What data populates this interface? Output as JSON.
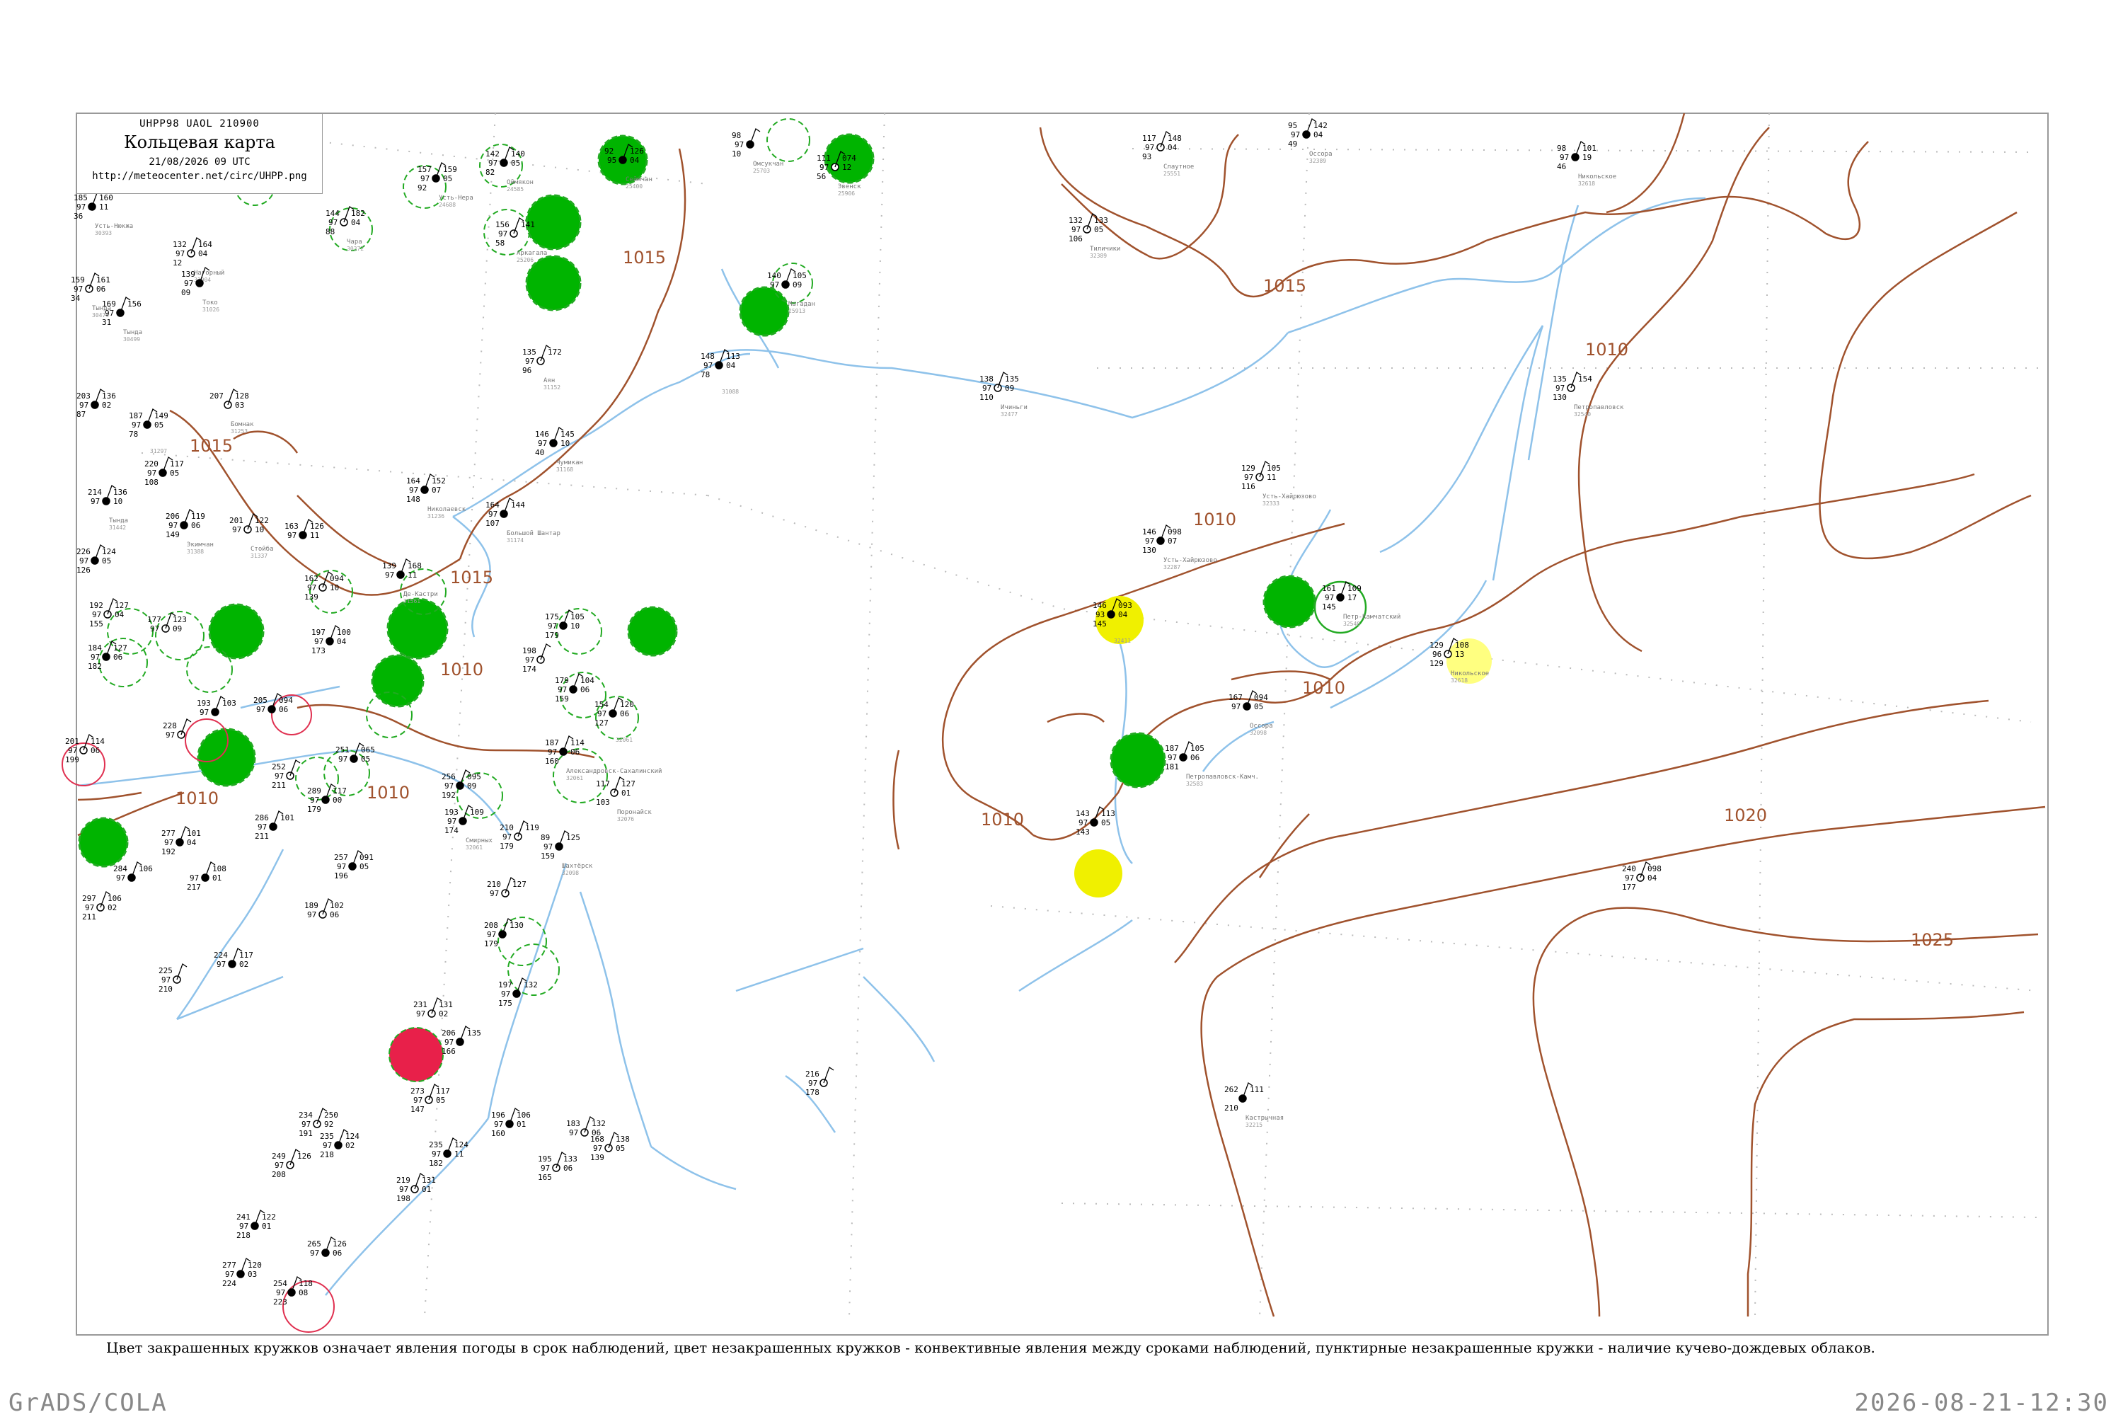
{
  "header": {
    "code": "UHPP98  UAOL  210900",
    "title": "Кольцевая карта",
    "datetime": "21/08/2026 09 UTC",
    "url": "http://meteocenter.net/circ/UHPP.png"
  },
  "caption": "Цвет закрашенных кружков означает явления погоды в срок наблюдений, цвет незакрашенных кружков - конвективные явления между сроками наблюдений, пунктирные незакрашенные кружки - наличие кучево-дождевых облаков.",
  "footer": {
    "left": "GrADS/COLA",
    "right": "2026-08-21-12:30"
  },
  "colors": {
    "isobar": "#a0522d",
    "river": "#87bde8",
    "green_fill": "#00b400",
    "yellow_fill": "#f0f000",
    "light_yellow_fill": "#ffff80",
    "red_fill": "#e8204a",
    "dashed_green": "#22aa22",
    "red_ring": "#e03050"
  },
  "isobar_labels": [
    {
      "text": "1015",
      "id": "a"
    },
    {
      "text": "1015",
      "id": "b"
    },
    {
      "text": "1015",
      "id": "c"
    },
    {
      "text": "1015",
      "id": "d"
    },
    {
      "text": "1010",
      "id": "e"
    },
    {
      "text": "1010",
      "id": "f"
    },
    {
      "text": "1010",
      "id": "g"
    },
    {
      "text": "1010",
      "id": "h"
    },
    {
      "text": "1010",
      "id": "i"
    },
    {
      "text": "1010",
      "id": "j"
    },
    {
      "text": "1020",
      "id": "k"
    },
    {
      "text": "1025",
      "id": "l"
    },
    {
      "text": "1010",
      "id": "m"
    }
  ],
  "stations": [
    {
      "id": "s1",
      "a": "185",
      "b": "97",
      "c": "36",
      "r": "160",
      "s": "11",
      "name": "Усть-Нюкжа",
      "wmo": "30393"
    },
    {
      "id": "s2",
      "a": "144",
      "b": "97",
      "c": "88",
      "r": "182",
      "s": "04",
      "name": "Чара",
      "wmo": "30372"
    },
    {
      "id": "s3",
      "a": "157",
      "b": "97",
      "c": "92",
      "r": "159",
      "s": "05",
      "name": "Усть-Нера",
      "wmo": "24688"
    },
    {
      "id": "s4",
      "a": "142",
      "b": "97",
      "c": "82",
      "r": "140",
      "s": "05",
      "name": "Оймякон",
      "wmo": "24585"
    },
    {
      "id": "s5",
      "a": "92",
      "b": "95",
      "c": "",
      "r": "126",
      "s": "04",
      "name": "Сеймчан",
      "wmo": "25400"
    },
    {
      "id": "s6",
      "a": "98",
      "b": "97",
      "c": "10",
      "r": "",
      "s": "",
      "name": "Омсукчан",
      "wmo": "25703"
    },
    {
      "id": "s7",
      "a": "111",
      "b": "97",
      "c": "56",
      "r": "074",
      "s": "12",
      "name": "Эвенск",
      "wmo": "25906"
    },
    {
      "id": "s8",
      "a": "117",
      "b": "97",
      "c": "93",
      "r": "148",
      "s": "04",
      "name": "Слаутное",
      "wmo": "25551"
    },
    {
      "id": "s9",
      "a": "95",
      "b": "97",
      "c": "49",
      "r": "142",
      "s": "04",
      "name": "Оссора",
      "wmo": "32389"
    },
    {
      "id": "s10",
      "a": "98",
      "b": "97",
      "c": "46",
      "r": "101",
      "s": "19",
      "name": "Никольское",
      "wmo": "32618"
    },
    {
      "id": "s11",
      "a": "132",
      "b": "97",
      "c": "12",
      "r": "164",
      "s": "04",
      "name": "Нагорный",
      "wmo": "31004"
    },
    {
      "id": "s12",
      "a": "139",
      "b": "97",
      "c": "09",
      "r": "",
      "s": "",
      "name": "Токо",
      "wmo": "31026"
    },
    {
      "id": "s13",
      "a": "156",
      "b": "97",
      "c": "58",
      "r": "141",
      "s": "",
      "name": "Аркагала",
      "wmo": "25206"
    },
    {
      "id": "s14",
      "a": "140",
      "b": "97",
      "c": "",
      "r": "105",
      "s": "09",
      "name": "Магадан",
      "wmo": "25913"
    },
    {
      "id": "s15",
      "a": "132",
      "b": "97",
      "c": "106",
      "r": "133",
      "s": "05",
      "name": "Тиличики",
      "wmo": "32389"
    },
    {
      "id": "s16",
      "a": "159",
      "b": "97",
      "c": "34",
      "r": "161",
      "s": "06",
      "name": "Тында",
      "wmo": "30479"
    },
    {
      "id": "s17",
      "a": "169",
      "b": "97",
      "c": "31",
      "r": "156",
      "s": "",
      "name": "Тында",
      "wmo": "30499"
    },
    {
      "id": "s18",
      "a": "135",
      "b": "97",
      "c": "96",
      "r": "172",
      "s": "",
      "name": "Аян",
      "wmo": "31152"
    },
    {
      "id": "s19",
      "a": "148",
      "b": "97",
      "c": "78",
      "r": "113",
      "s": "04",
      "name": "",
      "wmo": "31088"
    },
    {
      "id": "s20",
      "a": "138",
      "b": "97",
      "c": "110",
      "r": "135",
      "s": "09",
      "name": "Ичиньги",
      "wmo": "32477"
    },
    {
      "id": "s21",
      "a": "135",
      "b": "97",
      "c": "130",
      "r": "154",
      "s": "",
      "name": "Петропавловск",
      "wmo": "32540"
    },
    {
      "id": "s22",
      "a": "203",
      "b": "97",
      "c": "87",
      "r": "136",
      "s": "02",
      "name": "",
      "wmo": ""
    },
    {
      "id": "s23",
      "a": "207",
      "b": "",
      "c": "",
      "r": "128",
      "s": "03",
      "name": "Бомнак",
      "wmo": "31253"
    },
    {
      "id": "s24",
      "a": "187",
      "b": "97",
      "c": "78",
      "r": "149",
      "s": "05",
      "name": "",
      "wmo": "31297"
    },
    {
      "id": "s25",
      "a": "146",
      "b": "97",
      "c": "40",
      "r": "145",
      "s": "10",
      "name": "Чумикан",
      "wmo": "31168"
    },
    {
      "id": "s26",
      "a": "164",
      "b": "97",
      "c": "148",
      "r": "152",
      "s": "07",
      "name": "Николаевск",
      "wmo": "31236"
    },
    {
      "id": "s27",
      "a": "164",
      "b": "97",
      "c": "107",
      "r": "144",
      "s": "",
      "name": "Большой Шантар",
      "wmo": "31174"
    },
    {
      "id": "s28",
      "a": "129",
      "b": "97",
      "c": "116",
      "r": "105",
      "s": "11",
      "name": "Усть-Хайрюзово",
      "wmo": "32333"
    },
    {
      "id": "s29",
      "a": "146",
      "b": "97",
      "c": "130",
      "r": "098",
      "s": "07",
      "name": "Усть-Хайрюзово",
      "wmo": "32287"
    },
    {
      "id": "s30",
      "a": "220",
      "b": "97",
      "c": "108",
      "r": "117",
      "s": "05",
      "name": "",
      "wmo": ""
    },
    {
      "id": "s31",
      "a": "214",
      "b": "97",
      "c": "",
      "r": "136",
      "s": "10",
      "name": "Тында",
      "wmo": "31442"
    },
    {
      "id": "s32",
      "a": "206",
      "b": "97",
      "c": "149",
      "r": "119",
      "s": "06",
      "name": "Экимчан",
      "wmo": "31388"
    },
    {
      "id": "s33",
      "a": "201",
      "b": "97",
      "c": "",
      "r": "122",
      "s": "10",
      "name": "Стойба",
      "wmo": "31337"
    },
    {
      "id": "s34",
      "a": "163",
      "b": "97",
      "c": "",
      "r": "126",
      "s": "11",
      "name": "",
      "wmo": ""
    },
    {
      "id": "s35",
      "a": "226",
      "b": "97",
      "c": "126",
      "r": "124",
      "s": "05",
      "name": "",
      "wmo": ""
    },
    {
      "id": "s36",
      "a": "162",
      "b": "97",
      "c": "139",
      "r": "094",
      "s": "10",
      "name": "",
      "wmo": ""
    },
    {
      "id": "s37",
      "a": "139",
      "b": "97",
      "c": "",
      "r": "168",
      "s": "11",
      "name": "Де-Кастри",
      "wmo": "31561"
    },
    {
      "id": "s38",
      "a": "146",
      "b": "93",
      "c": "145",
      "r": "093",
      "s": "04",
      "name": "",
      "wmo": "32411"
    },
    {
      "id": "s39",
      "a": "129",
      "b": "96",
      "c": "129",
      "r": "108",
      "s": "13",
      "name": "Никольское",
      "wmo": "32618"
    },
    {
      "id": "s40",
      "a": "161",
      "b": "97",
      "c": "145",
      "r": "109",
      "s": "17",
      "name": "Петр-Камчатский",
      "wmo": "32540"
    },
    {
      "id": "s41",
      "a": "192",
      "b": "97",
      "c": "155",
      "r": "127",
      "s": "04",
      "name": "",
      "wmo": ""
    },
    {
      "id": "s42",
      "a": "177",
      "b": "97",
      "c": "",
      "r": "123",
      "s": "09",
      "name": "",
      "wmo": ""
    },
    {
      "id": "s43",
      "a": "197",
      "b": "97",
      "c": "173",
      "r": "100",
      "s": "04",
      "name": "",
      "wmo": ""
    },
    {
      "id": "s44",
      "a": "175",
      "b": "97",
      "c": "179",
      "r": "105",
      "s": "10",
      "name": "",
      "wmo": ""
    },
    {
      "id": "s45",
      "a": "184",
      "b": "97",
      "c": "182",
      "r": "127",
      "s": "06",
      "name": "",
      "wmo": ""
    },
    {
      "id": "s46",
      "a": "198",
      "b": "97",
      "c": "174",
      "r": "",
      "s": "",
      "name": "",
      "wmo": ""
    },
    {
      "id": "s47",
      "a": "179",
      "b": "97",
      "c": "159",
      "r": "104",
      "s": "06",
      "name": "",
      "wmo": ""
    },
    {
      "id": "s48",
      "a": "154",
      "b": "97",
      "c": "127",
      "r": "120",
      "s": "06",
      "name": "",
      "wmo": "32061"
    },
    {
      "id": "s49",
      "a": "167",
      "b": "97",
      "c": "",
      "r": "094",
      "s": "05",
      "name": "Оссора",
      "wmo": "32098"
    },
    {
      "id": "s50",
      "a": "187",
      "b": "97",
      "c": "181",
      "r": "105",
      "s": "06",
      "name": "Петропавловск-Камч.",
      "wmo": "32583"
    },
    {
      "id": "s51",
      "a": "201",
      "b": "97",
      "c": "199",
      "r": "114",
      "s": "06",
      "name": "",
      "wmo": ""
    },
    {
      "id": "s52",
      "a": "193",
      "b": "97",
      "c": "",
      "r": "103",
      "s": "",
      "name": "",
      "wmo": ""
    },
    {
      "id": "s53",
      "a": "205",
      "b": "97",
      "c": "",
      "r": "094",
      "s": "06",
      "name": "",
      "wmo": ""
    },
    {
      "id": "s54",
      "a": "228",
      "b": "97",
      "c": "",
      "r": "",
      "s": "",
      "name": "",
      "wmo": ""
    },
    {
      "id": "s55",
      "a": "252",
      "b": "97",
      "c": "211",
      "r": "",
      "s": "",
      "name": "",
      "wmo": ""
    },
    {
      "id": "s56",
      "a": "251",
      "b": "97",
      "c": "",
      "r": "065",
      "s": "05",
      "name": "",
      "wmo": ""
    },
    {
      "id": "s57",
      "a": "289",
      "b": "97",
      "c": "179",
      "r": "117",
      "s": "00",
      "name": "",
      "wmo": ""
    },
    {
      "id": "s58",
      "a": "256",
      "b": "97",
      "c": "192",
      "r": "095",
      "s": "09",
      "name": "",
      "wmo": ""
    },
    {
      "id": "s59",
      "a": "193",
      "b": "97",
      "c": "174",
      "r": "109",
      "s": "",
      "name": "Смирных",
      "wmo": "32061"
    },
    {
      "id": "s60",
      "a": "187",
      "b": "97",
      "c": "160",
      "r": "114",
      "s": "06",
      "name": "Александровск-Сахалинский",
      "wmo": "32061"
    },
    {
      "id": "s61",
      "a": "117",
      "b": "",
      "c": "103",
      "r": "127",
      "s": "01",
      "name": "Поронайск",
      "wmo": "32076"
    },
    {
      "id": "s62",
      "a": "210",
      "b": "97",
      "c": "179",
      "r": "119",
      "s": "",
      "name": "",
      "wmo": ""
    },
    {
      "id": "s63",
      "a": "89",
      "b": "97",
      "c": "159",
      "r": "125",
      "s": "",
      "name": "Шахтёрск",
      "wmo": "32098"
    },
    {
      "id": "s64",
      "a": "277",
      "b": "97",
      "c": "192",
      "r": "101",
      "s": "04",
      "name": "",
      "wmo": ""
    },
    {
      "id": "s65",
      "a": "286",
      "b": "97",
      "c": "211",
      "r": "101",
      "s": "",
      "name": "",
      "wmo": ""
    },
    {
      "id": "s66",
      "a": "257",
      "b": "97",
      "c": "196",
      "r": "091",
      "s": "05",
      "name": "",
      "wmo": ""
    },
    {
      "id": "s67",
      "a": "284",
      "b": "97",
      "c": "",
      "r": "106",
      "s": "",
      "name": "",
      "wmo": ""
    },
    {
      "id": "s68",
      "a": "297",
      "b": "97",
      "c": "211",
      "r": "106",
      "s": "02",
      "name": "",
      "wmo": ""
    },
    {
      "id": "s69",
      "a": "",
      "b": "97",
      "c": "217",
      "r": "108",
      "s": "01",
      "name": "",
      "wmo": ""
    },
    {
      "id": "s70",
      "a": "189",
      "b": "97",
      "c": "",
      "r": "102",
      "s": "06",
      "name": "",
      "wmo": ""
    },
    {
      "id": "s71",
      "a": "210",
      "b": "97",
      "c": "",
      "r": "127",
      "s": "",
      "name": "",
      "wmo": ""
    },
    {
      "id": "s72",
      "a": "208",
      "b": "97",
      "c": "179",
      "r": "130",
      "s": "",
      "name": "",
      "wmo": ""
    },
    {
      "id": "s73",
      "a": "197",
      "b": "97",
      "c": "175",
      "r": "132",
      "s": "",
      "name": "",
      "wmo": ""
    },
    {
      "id": "s74",
      "a": "224",
      "b": "97",
      "c": "",
      "r": "117",
      "s": "02",
      "name": "",
      "wmo": ""
    },
    {
      "id": "s75",
      "a": "225",
      "b": "97",
      "c": "210",
      "r": "",
      "s": "",
      "name": "",
      "wmo": ""
    },
    {
      "id": "s76",
      "a": "231",
      "b": "97",
      "c": "",
      "r": "131",
      "s": "02",
      "name": "",
      "wmo": ""
    },
    {
      "id": "s77",
      "a": "206",
      "b": "97",
      "c": "166",
      "r": "135",
      "s": "",
      "name": "",
      "wmo": ""
    },
    {
      "id": "s78",
      "a": "273",
      "b": "97",
      "c": "147",
      "r": "117",
      "s": "05",
      "name": "",
      "wmo": ""
    },
    {
      "id": "s79",
      "a": "196",
      "b": "97",
      "c": "160",
      "r": "106",
      "s": "01",
      "name": "",
      "wmo": ""
    },
    {
      "id": "s80",
      "a": "183",
      "b": "97",
      "c": "",
      "r": "132",
      "s": "06",
      "name": "",
      "wmo": ""
    },
    {
      "id": "s81",
      "a": "168",
      "b": "97",
      "c": "139",
      "r": "138",
      "s": "05",
      "name": "",
      "wmo": ""
    },
    {
      "id": "s82",
      "a": "216",
      "b": "97",
      "c": "178",
      "r": "",
      "s": "",
      "name": "",
      "wmo": ""
    },
    {
      "id": "s83",
      "a": "143",
      "b": "97",
      "c": "143",
      "r": "113",
      "s": "05",
      "name": "",
      "wmo": ""
    },
    {
      "id": "s84",
      "a": "240",
      "b": "97",
      "c": "177",
      "r": "098",
      "s": "04",
      "name": "",
      "wmo": ""
    },
    {
      "id": "s85",
      "a": "262",
      "b": "",
      "c": "210",
      "r": "111",
      "s": "",
      "name": "Кастрычная",
      "wmo": "32215"
    },
    {
      "id": "s86",
      "a": "234",
      "b": "97",
      "c": "191",
      "r": "250",
      "s": "92",
      "name": "",
      "wmo": ""
    },
    {
      "id": "s87",
      "a": "235",
      "b": "97",
      "c": "218",
      "r": "124",
      "s": "02",
      "name": "",
      "wmo": ""
    },
    {
      "id": "s88",
      "a": "235",
      "b": "97",
      "c": "182",
      "r": "124",
      "s": "11",
      "name": "",
      "wmo": ""
    },
    {
      "id": "s89",
      "a": "195",
      "b": "97",
      "c": "165",
      "r": "133",
      "s": "06",
      "name": "",
      "wmo": ""
    },
    {
      "id": "s90",
      "a": "249",
      "b": "97",
      "c": "208",
      "r": "126",
      "s": "",
      "name": "",
      "wmo": ""
    },
    {
      "id": "s91",
      "a": "241",
      "b": "97",
      "c": "218",
      "r": "122",
      "s": "01",
      "name": "",
      "wmo": ""
    },
    {
      "id": "s92",
      "a": "277",
      "b": "97",
      "c": "224",
      "r": "120",
      "s": "03",
      "name": "",
      "wmo": ""
    },
    {
      "id": "s93",
      "a": "265",
      "b": "97",
      "c": "",
      "r": "126",
      "s": "06",
      "name": "",
      "wmo": ""
    },
    {
      "id": "s94",
      "a": "254",
      "b": "97",
      "c": "223",
      "r": "118",
      "s": "08",
      "name": "",
      "wmo": ""
    },
    {
      "id": "s95",
      "a": "219",
      "b": "97",
      "c": "198",
      "r": "131",
      "s": "01",
      "name": "",
      "wmo": ""
    }
  ]
}
